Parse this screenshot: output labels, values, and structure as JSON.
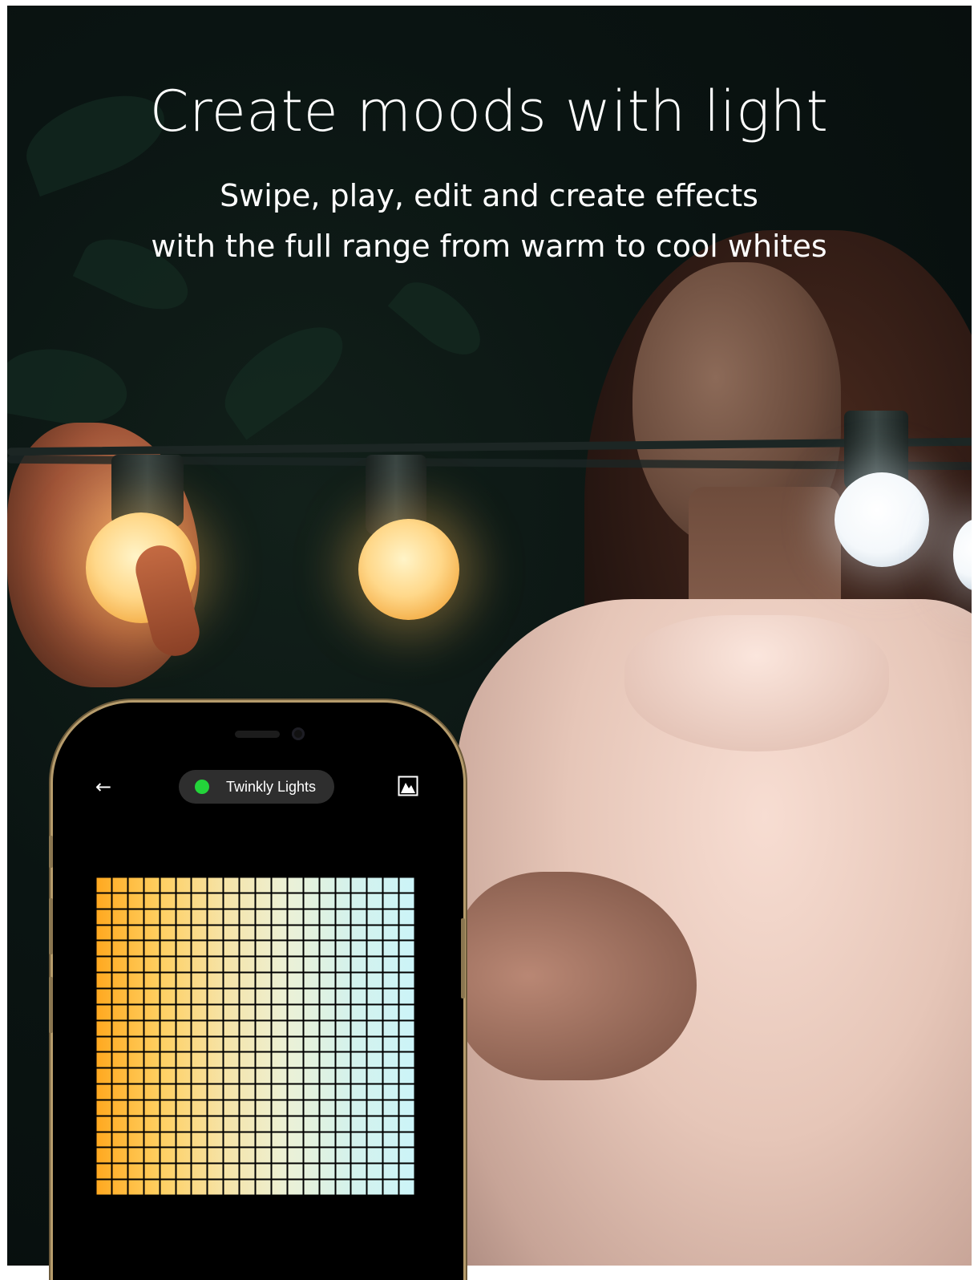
{
  "hero": {
    "headline": "Create moods with light",
    "subline_1": "Swipe, play, edit and create effects",
    "subline_2": "with the full range from warm to cool whites"
  },
  "phone": {
    "header": {
      "back_icon": "←",
      "device_name": "Twinkly Lights",
      "status_color": "#23d43a",
      "preview_icon": "image-icon"
    },
    "led_grid": {
      "columns": 20,
      "rows": 20,
      "gradient_colors": [
        "#ffa81f",
        "#ffcf60",
        "#f6e3a6",
        "#ecf1d6",
        "#d4f2ec",
        "#ccf4f8"
      ]
    }
  }
}
